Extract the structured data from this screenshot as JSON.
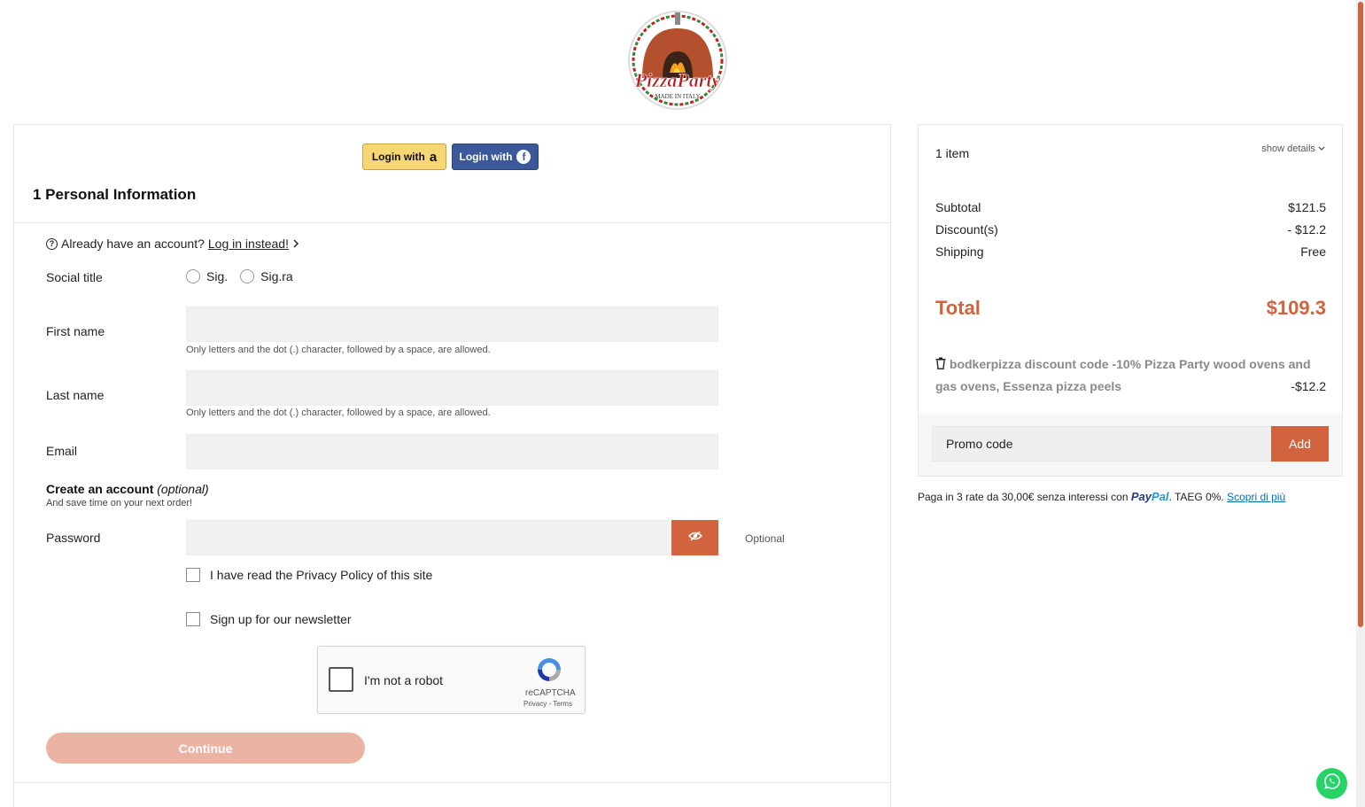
{
  "logo": {
    "brand": "PizzaParty",
    "tagline": "MADE IN ITALY"
  },
  "social_login": {
    "amazon_label": "Login with",
    "amazon_glyph": "a",
    "facebook_label": "Login with",
    "facebook_glyph": "f"
  },
  "step": {
    "title": "1 Personal Information"
  },
  "account_prompt": {
    "text": "Already have an account?",
    "link": "Log in instead!"
  },
  "form": {
    "social_title_label": "Social title",
    "social_title_options": [
      "Sig.",
      "Sig.ra"
    ],
    "first_name_label": "First name",
    "first_name_hint": "Only letters and the dot (.) character, followed by a space, are allowed.",
    "last_name_label": "Last name",
    "last_name_hint": "Only letters and the dot (.) character, followed by a space, are allowed.",
    "email_label": "Email",
    "create_account_title": "Create an account",
    "create_account_optional": "(optional)",
    "create_account_sub": "And save time on your next order!",
    "password_label": "Password",
    "password_optional": "Optional",
    "privacy_label": "I have read the Privacy Policy of this site",
    "newsletter_label": "Sign up for our newsletter",
    "continue_label": "Continue"
  },
  "recaptcha": {
    "label": "I'm not a robot",
    "brand": "reCAPTCHA",
    "terms": "Privacy - Terms"
  },
  "summary": {
    "items_count": "1 item",
    "show_details": "show details",
    "subtotal_label": "Subtotal",
    "subtotal_value": "$121.5",
    "discount_label": "Discount(s)",
    "discount_value": "- $12.2",
    "shipping_label": "Shipping",
    "shipping_value": "Free",
    "total_label": "Total",
    "total_value": "$109.3",
    "discount_code_text": "bodkerpizza discount code -10% Pizza Party wood ovens and gas ovens, Essenza pizza peels",
    "discount_code_amount": "-$12.2",
    "promo_placeholder": "Promo code",
    "promo_button": "Add"
  },
  "paypal": {
    "message": "Paga in 3 rate da 30,00€ senza interessi con",
    "logo_part1": "Pay",
    "logo_part2": "Pal",
    "suffix": ". TAEG 0%.",
    "link": "Scopri di più"
  },
  "colors": {
    "accent": "#d2633f",
    "accent_light": "#ebb3a4",
    "amazon": "#f7d774",
    "facebook": "#3b5998",
    "whatsapp": "#25d366"
  },
  "icons": [
    "question-circle-icon",
    "chevron-right-icon",
    "eye-slash-icon",
    "chevron-down-icon",
    "trash-icon",
    "recaptcha-icon",
    "whatsapp-icon",
    "amazon-icon",
    "facebook-icon"
  ]
}
